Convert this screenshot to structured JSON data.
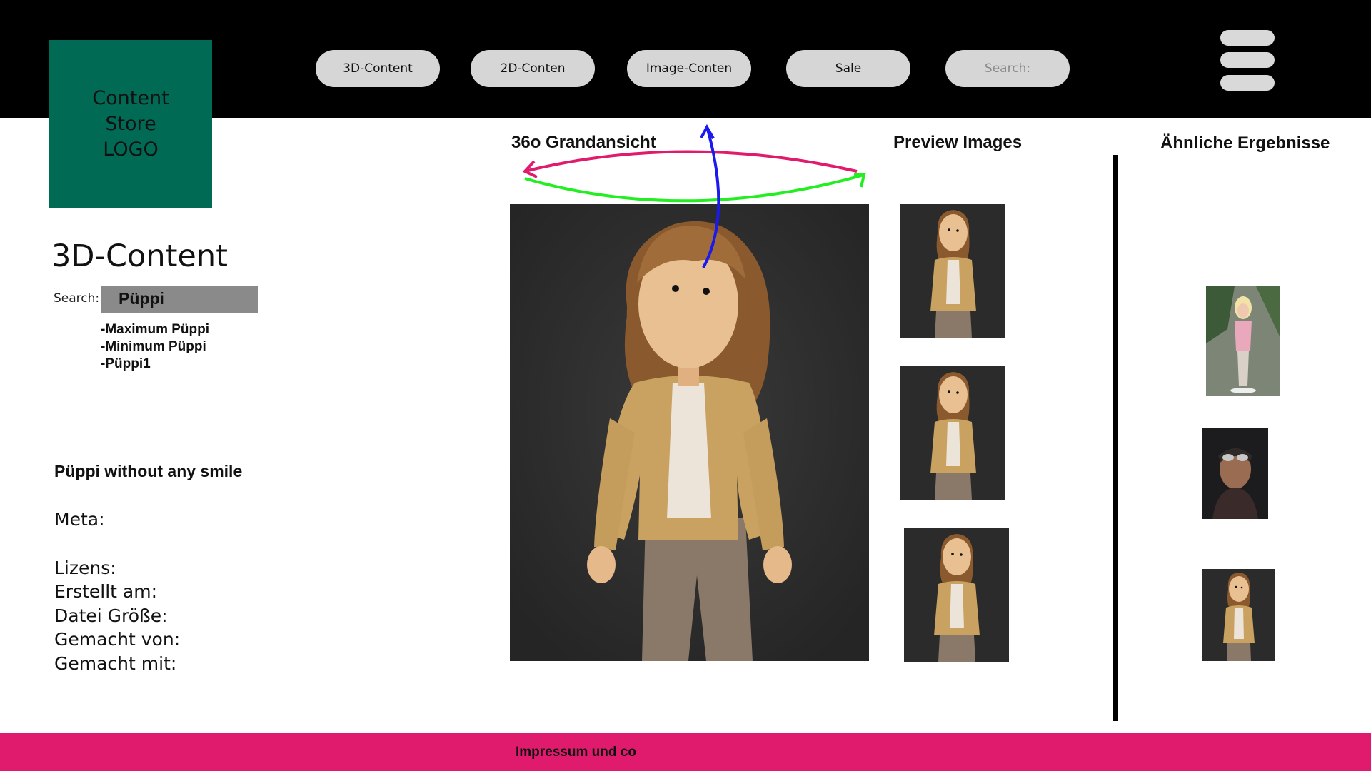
{
  "logo": {
    "text_line1": "Content",
    "text_line2": "Store",
    "text_line3": "LOGO"
  },
  "nav": [
    {
      "label": "3D-Content"
    },
    {
      "label": "2D-Conten"
    },
    {
      "label": "Image-Conten"
    },
    {
      "label": "Sale"
    },
    {
      "label": "Search:"
    }
  ],
  "sidebar": {
    "title": "3D-Content",
    "search_label": "Search:",
    "search_value": "Püppi",
    "suggestions": [
      "-Maximum Püppi",
      "-Minimum Püppi",
      "-Püppi1"
    ],
    "item_title": "Püppi without any smile",
    "meta_label": "Meta:",
    "meta_fields": [
      "Lizens:",
      "Erstellt am:",
      "Datei Größe:",
      "Gemacht von:",
      "Gemacht mit:"
    ]
  },
  "main": {
    "viewer_title": "36o Grandansicht",
    "preview_title": "Preview Images",
    "similar_title": "Ähnliche Ergebnisse"
  },
  "footer": {
    "text": "Impressum und co"
  },
  "colors": {
    "topbar": "#000000",
    "logo_bg": "#006a55",
    "pill_bg": "#d6d6d6",
    "footer_bg": "#e01a6c",
    "arc_pink": "#e01a6c",
    "arc_green": "#22ee22",
    "arc_blue": "#1a1aee"
  },
  "icons": [
    "hamburger-menu-icon",
    "rotate-horizontal-arrow-icon",
    "rotate-vertical-arrow-icon"
  ]
}
